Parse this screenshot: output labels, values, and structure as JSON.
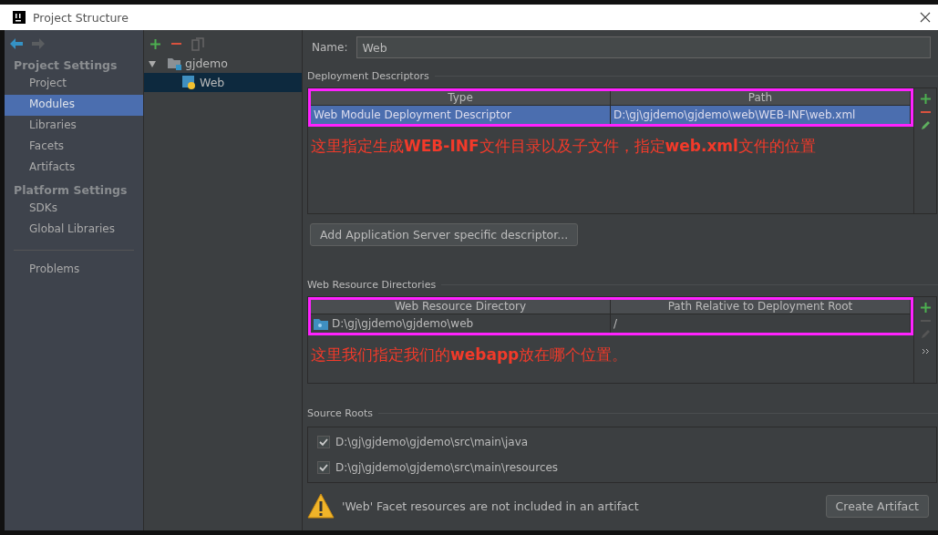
{
  "window": {
    "title": "Project Structure"
  },
  "sidebar": {
    "sections": [
      {
        "title": "Project Settings",
        "items": [
          {
            "label": "Project",
            "selected": false
          },
          {
            "label": "Modules",
            "selected": true
          },
          {
            "label": "Libraries",
            "selected": false
          },
          {
            "label": "Facets",
            "selected": false
          },
          {
            "label": "Artifacts",
            "selected": false
          }
        ]
      },
      {
        "title": "Platform Settings",
        "items": [
          {
            "label": "SDKs",
            "selected": false
          },
          {
            "label": "Global Libraries",
            "selected": false
          }
        ]
      }
    ],
    "bottom_items": [
      {
        "label": "Problems",
        "selected": false
      }
    ]
  },
  "tree": {
    "items": [
      {
        "label": "gjdemo",
        "expanded": true,
        "selected": false,
        "children": [
          {
            "label": "Web",
            "selected": true
          }
        ]
      }
    ]
  },
  "name_field": {
    "label": "Name:",
    "value": "Web"
  },
  "deployment_descriptors": {
    "title": "Deployment Descriptors",
    "columns": [
      "Type",
      "Path"
    ],
    "rows": [
      {
        "cells": [
          "Web Module Deployment Descriptor",
          "D:\\gj\\gjdemo\\gjdemo\\web\\WEB-INF\\web.xml"
        ],
        "selected": true,
        "folder_icon": false
      }
    ],
    "annotation": "这里指定生成**WEB-INF**文件目录以及子文件，指定**web.xml**文件的位置",
    "tools": [
      {
        "kind": "add",
        "disabled": false
      },
      {
        "kind": "remove",
        "disabled": false
      },
      {
        "kind": "edit",
        "disabled": false
      }
    ]
  },
  "add_descriptor_button": "Add Application Server specific descriptor...",
  "web_resource_directories": {
    "title": "Web Resource Directories",
    "columns": [
      "Web Resource Directory",
      "Path Relative to Deployment Root"
    ],
    "rows": [
      {
        "cells": [
          "D:\\gj\\gjdemo\\gjdemo\\web",
          "/"
        ],
        "selected": false,
        "folder_icon": true
      }
    ],
    "annotation": "这里我们指定我们的**webapp**放在哪个位置。",
    "tools": [
      {
        "kind": "add",
        "disabled": false
      },
      {
        "kind": "remove",
        "disabled": true
      },
      {
        "kind": "edit",
        "disabled": true
      },
      {
        "kind": "more",
        "disabled": false
      }
    ]
  },
  "source_roots": {
    "title": "Source Roots",
    "items": [
      {
        "path": "D:\\gj\\gjdemo\\gjdemo\\src\\main\\java",
        "checked": true
      },
      {
        "path": "D:\\gj\\gjdemo\\gjdemo\\src\\main\\resources",
        "checked": true
      }
    ]
  },
  "warning": {
    "message": "'Web' Facet resources are not included in an artifact",
    "button": "Create Artifact"
  }
}
